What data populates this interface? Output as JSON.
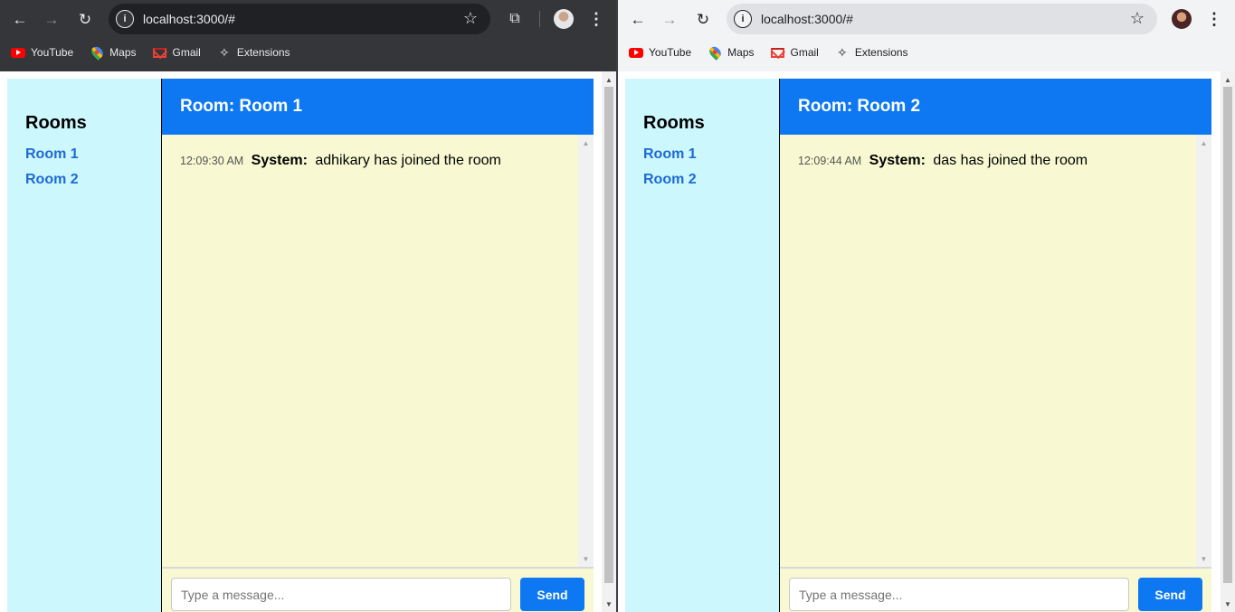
{
  "windows": [
    {
      "url": "localhost:3000/#",
      "bookmarks": [
        "YouTube",
        "Maps",
        "Gmail",
        "Extensions"
      ],
      "sidebar_title": "Rooms",
      "rooms": [
        "Room 1",
        "Room 2"
      ],
      "header": "Room: Room 1",
      "message": {
        "time": "12:09:30 AM",
        "sender": "System:",
        "text": "adhikary has joined the room"
      },
      "input_placeholder": "Type a message...",
      "send_label": "Send"
    },
    {
      "url": "localhost:3000/#",
      "bookmarks": [
        "YouTube",
        "Maps",
        "Gmail",
        "Extensions"
      ],
      "sidebar_title": "Rooms",
      "rooms": [
        "Room 1",
        "Room 2"
      ],
      "header": "Room: Room 2",
      "message": {
        "time": "12:09:44 AM",
        "sender": "System:",
        "text": "das has joined the room"
      },
      "input_placeholder": "Type a message...",
      "send_label": "Send"
    }
  ],
  "colors": {
    "header_blue": "#0d78f2",
    "sidebar_bg": "#ccf7fd",
    "chat_bg": "#f8f9d2",
    "room_link": "#1f6ad6"
  },
  "icons": [
    "back-arrow-icon",
    "forward-arrow-icon",
    "reload-icon",
    "info-icon",
    "star-icon",
    "extensions-icon",
    "profile-avatar",
    "menu-kebab-icon",
    "youtube-icon",
    "maps-icon",
    "gmail-icon",
    "puzzle-icon"
  ]
}
